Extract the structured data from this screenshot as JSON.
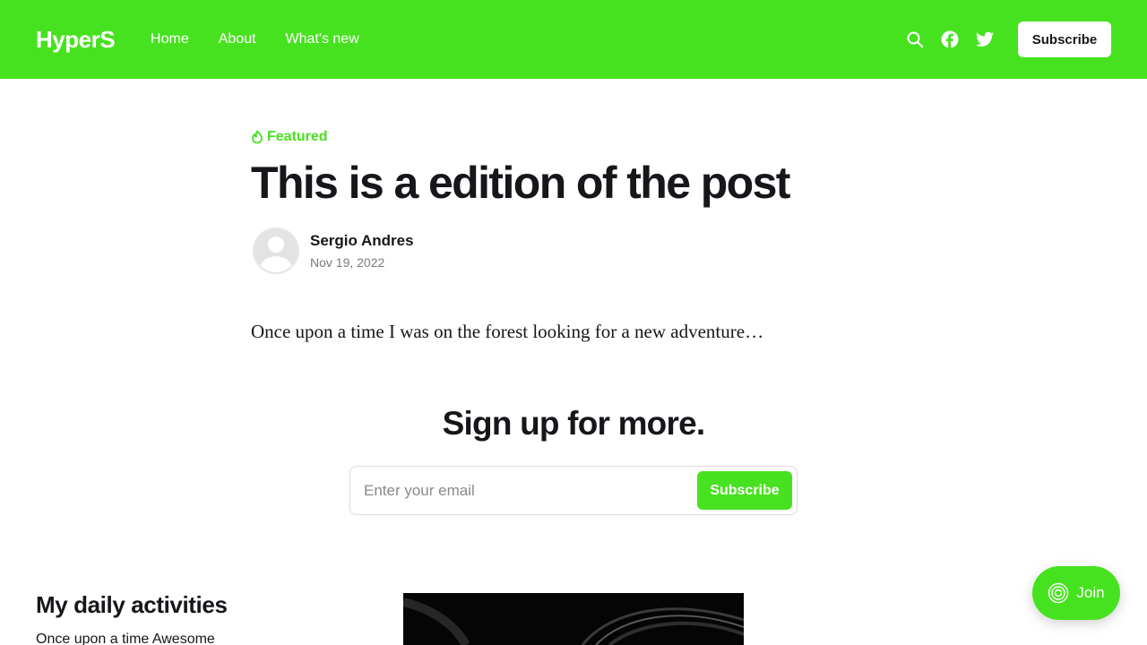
{
  "header": {
    "logo": "HyperS",
    "nav": [
      {
        "label": "Home"
      },
      {
        "label": "About"
      },
      {
        "label": "What's new"
      }
    ],
    "icons": [
      "search-icon",
      "facebook-icon",
      "twitter-icon"
    ],
    "subscribe_label": "Subscribe",
    "background_color": "#47e21f"
  },
  "post": {
    "tag": "Featured",
    "title": "This is a edition of the post",
    "author": "Sergio Andres",
    "date": "Nov 19, 2022",
    "excerpt": "Once upon a time I was on the forest looking for a new adventure…"
  },
  "signup": {
    "title": "Sign up for more.",
    "email_placeholder": "Enter your email",
    "button_label": "Subscribe"
  },
  "section": {
    "title": "My daily activities",
    "excerpt": "Once upon a time Awesome"
  },
  "join_button": {
    "label": "Join"
  }
}
